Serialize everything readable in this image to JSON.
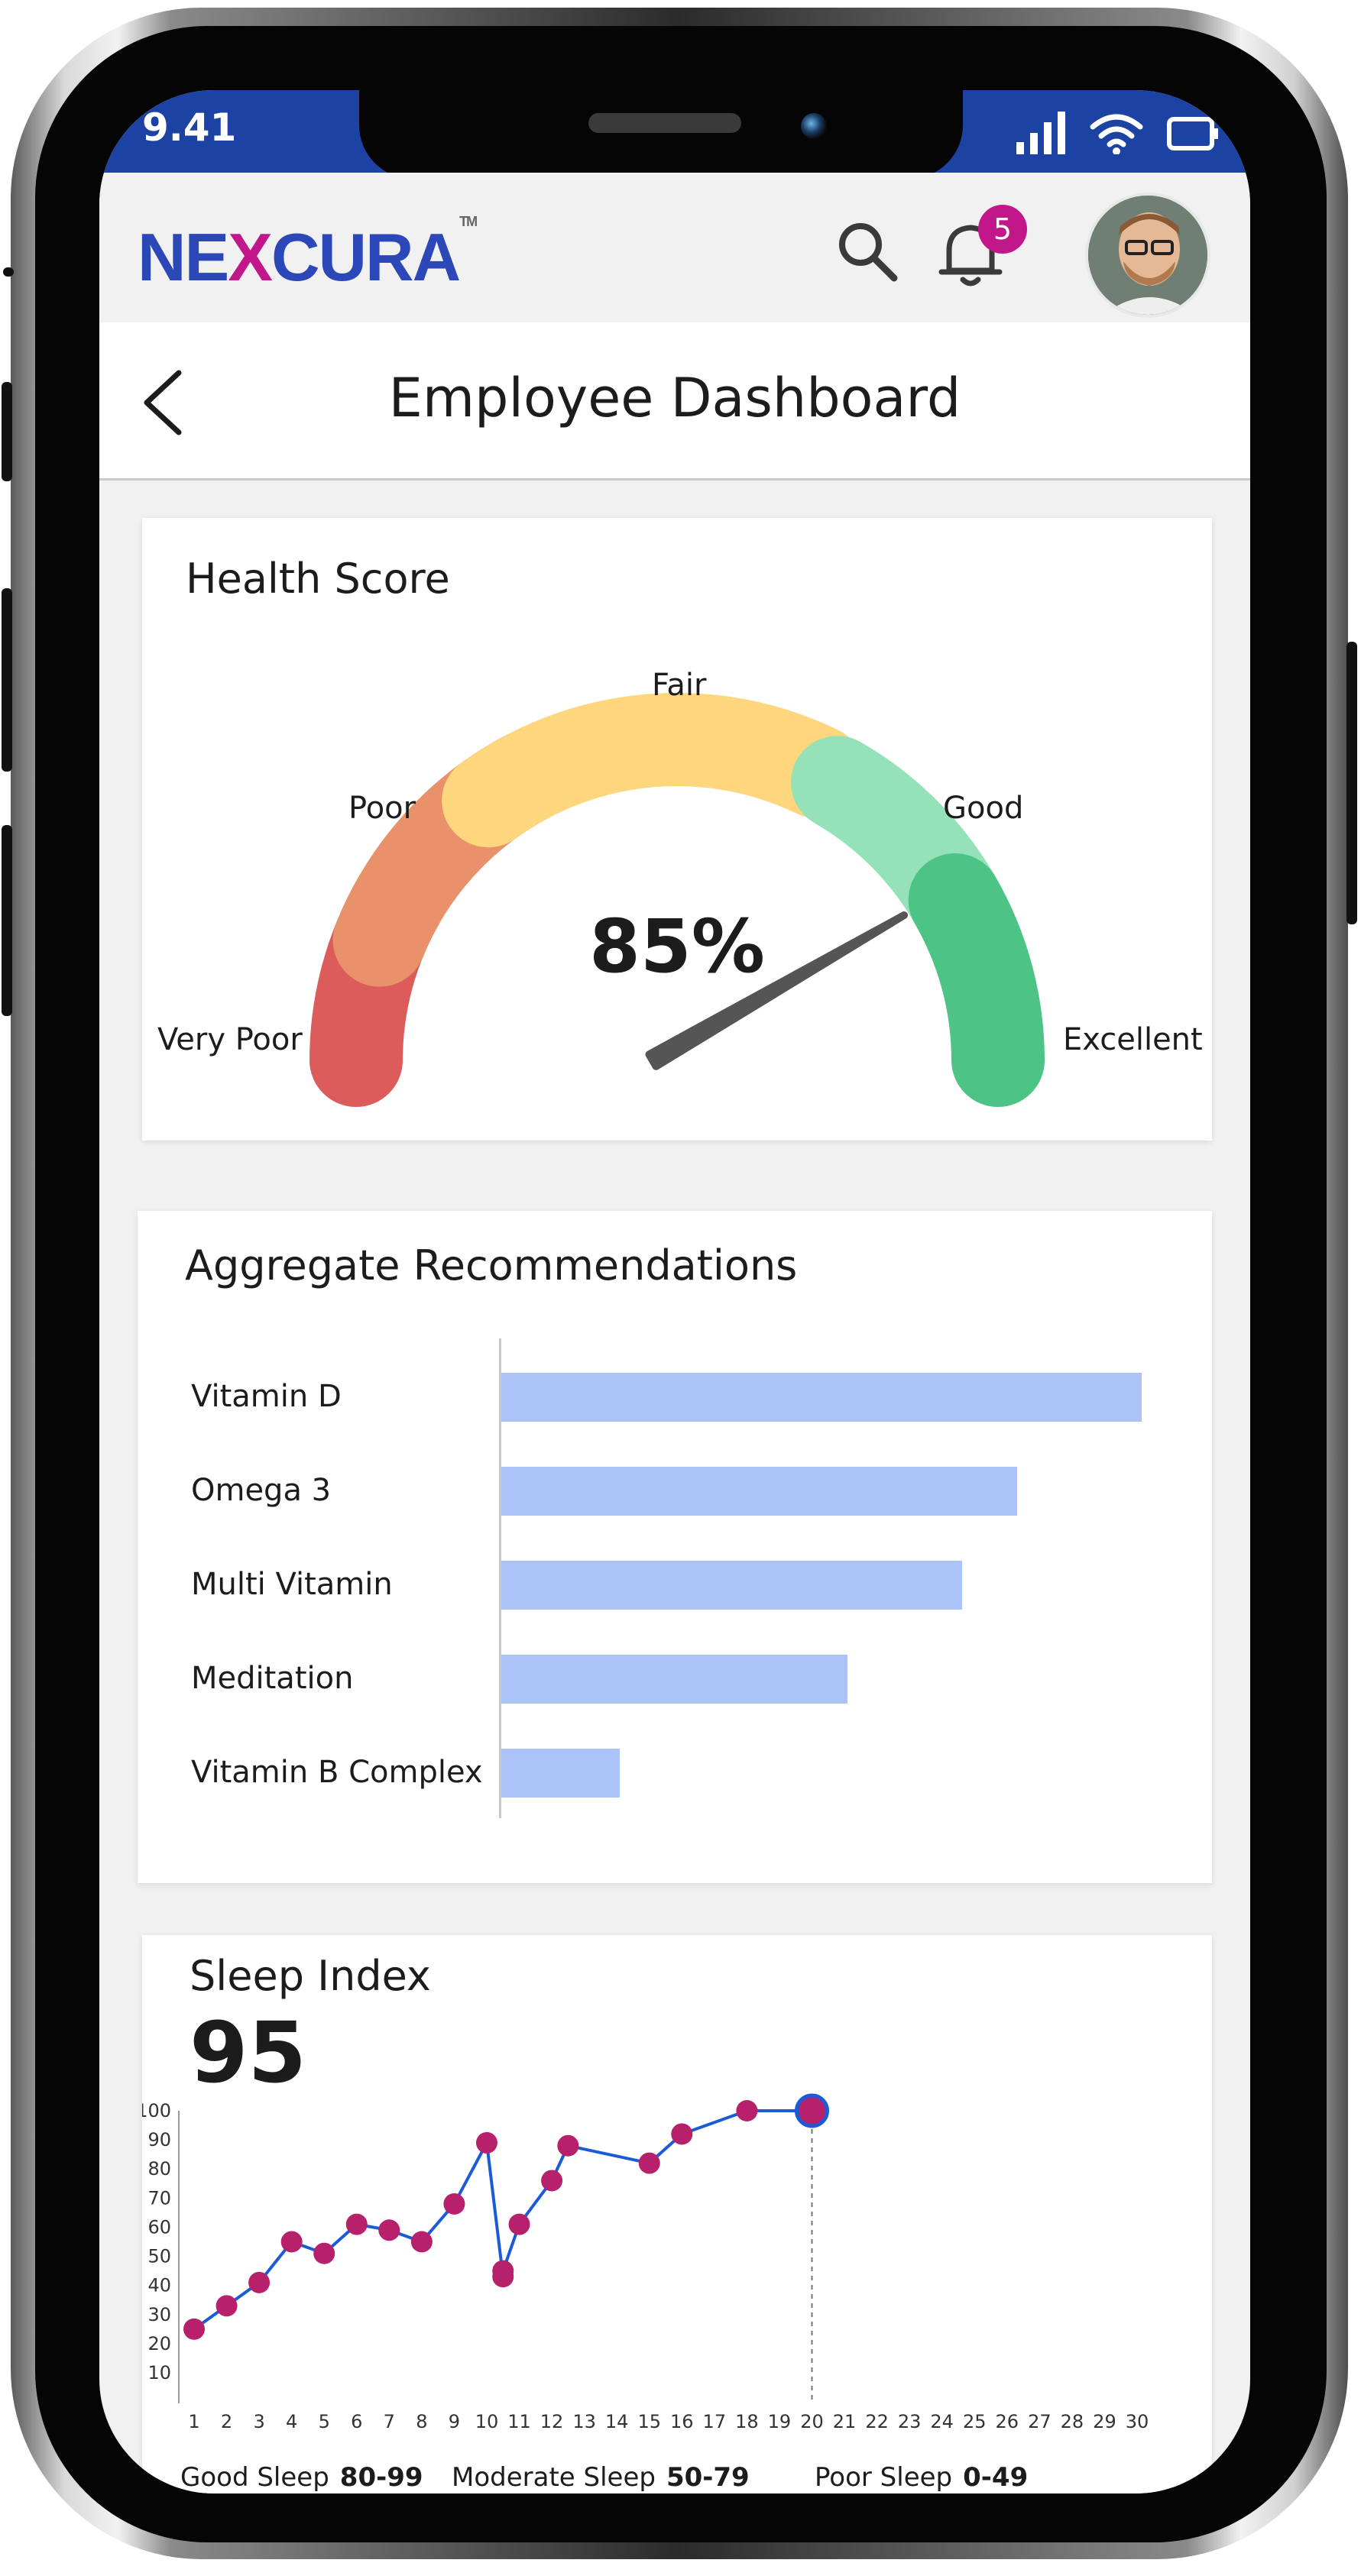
{
  "status_bar": {
    "time": "9.41"
  },
  "header": {
    "logo_main": "NE",
    "logo_x": "X",
    "logo_rest": "CURA",
    "logo_tm": "TM",
    "notification_count": "5"
  },
  "page": {
    "title": "Employee Dashboard"
  },
  "health_score": {
    "title": "Health Score",
    "value": "85%",
    "value_fraction": 0.85,
    "labels": {
      "very_poor": "Very Poor",
      "poor": "Poor",
      "fair": "Fair",
      "good": "Good",
      "excellent": "Excellent"
    },
    "colors": {
      "very_poor": "#dc5b5b",
      "poor": "#e8916a",
      "fair": "#fdd67e",
      "good": "#95e1b8",
      "excellent": "#4dc386",
      "needle": "#555555"
    }
  },
  "recommendations": {
    "title": "Aggregate Recommendations",
    "bar_color": "#abc3f6",
    "chart_data": {
      "type": "bar",
      "categories": [
        "Vitamin D",
        "Omega 3",
        "Multi Vitamin",
        "Meditation",
        "Vitamin B Complex"
      ],
      "values": [
        100,
        80.5,
        72,
        54,
        18.5
      ],
      "xlim": [
        0,
        100
      ]
    }
  },
  "sleep_index": {
    "title": "Sleep Index",
    "value": "95",
    "line_color": "#1c5bd6",
    "point_color": "#b7206a",
    "chart_data": {
      "type": "line",
      "x": [
        1,
        2,
        3,
        4,
        5,
        6,
        7,
        8,
        9,
        10,
        10.5,
        10.5,
        11,
        12,
        12.5,
        15,
        16,
        18,
        20
      ],
      "y": [
        25,
        33,
        41,
        55,
        51,
        61,
        59,
        55,
        68,
        89,
        43,
        45,
        61,
        76,
        88,
        82,
        92,
        100,
        100
      ],
      "x_ticks": [
        "1",
        "2",
        "3",
        "4",
        "5",
        "6",
        "7",
        "8",
        "9",
        "10",
        "11",
        "12",
        "13",
        "14",
        "15",
        "16",
        "17",
        "18",
        "19",
        "20",
        "21",
        "22",
        "23",
        "24",
        "25",
        "26",
        "27",
        "28",
        "29",
        "30"
      ],
      "y_ticks": [
        "10",
        "20",
        "30",
        "40",
        "50",
        "60",
        "70",
        "80",
        "90",
        "100"
      ],
      "ylim": [
        0,
        100
      ],
      "highlight_x": 20
    },
    "legend": [
      {
        "label": "Good Sleep",
        "range": "80-99"
      },
      {
        "label": "Moderate Sleep",
        "range": "50-79"
      },
      {
        "label": "Poor Sleep",
        "range": "0-49"
      }
    ]
  }
}
